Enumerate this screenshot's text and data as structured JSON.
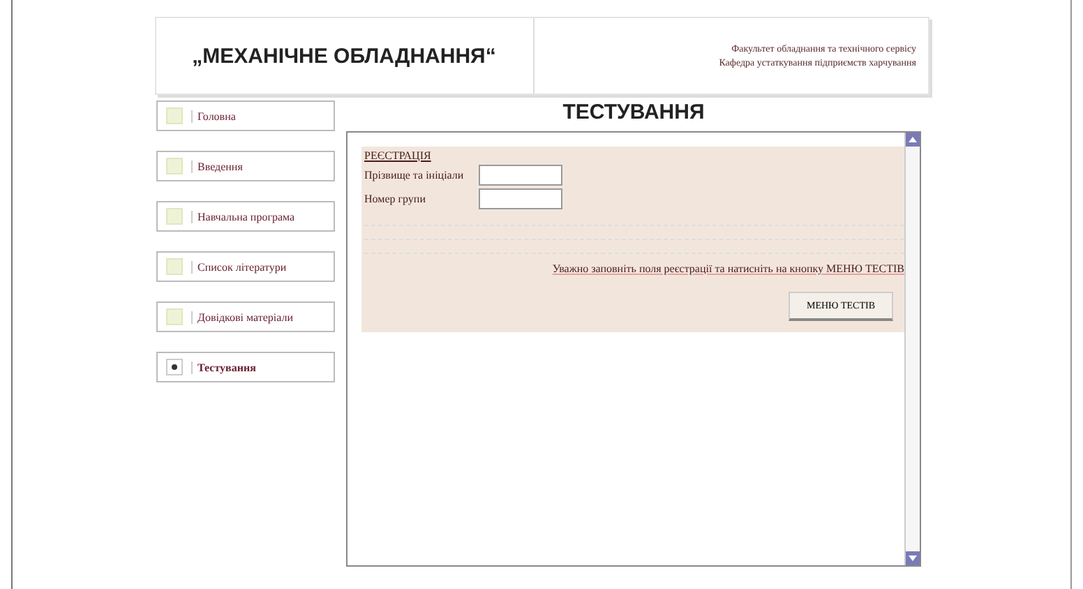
{
  "header": {
    "title": "„МЕХАНІЧНЕ ОБЛАДНАННЯ“",
    "faculty": "Факультет обладнання та технічного сервісу",
    "department": "Кафедра устаткування підприємств харчування"
  },
  "sidebar": {
    "items": [
      {
        "label": "Головна",
        "selected": false
      },
      {
        "label": "Введення",
        "selected": false
      },
      {
        "label": "Навчальна програма",
        "selected": false
      },
      {
        "label": "Список літератури",
        "selected": false
      },
      {
        "label": "Довідкові матеріали",
        "selected": false
      },
      {
        "label": "Тестування",
        "selected": true
      }
    ]
  },
  "page_title": "ТЕСТУВАННЯ",
  "form": {
    "heading": "РЕЄСТРАЦІЯ",
    "fields": [
      {
        "label": "Прізвище та ініціали"
      },
      {
        "label": "Номер групи"
      }
    ],
    "instruction": "Уважно заповніть поля реєстрації та натисніть на кнопку МЕНЮ ТЕСТІВ",
    "button": "МЕНЮ ТЕСТІВ"
  }
}
